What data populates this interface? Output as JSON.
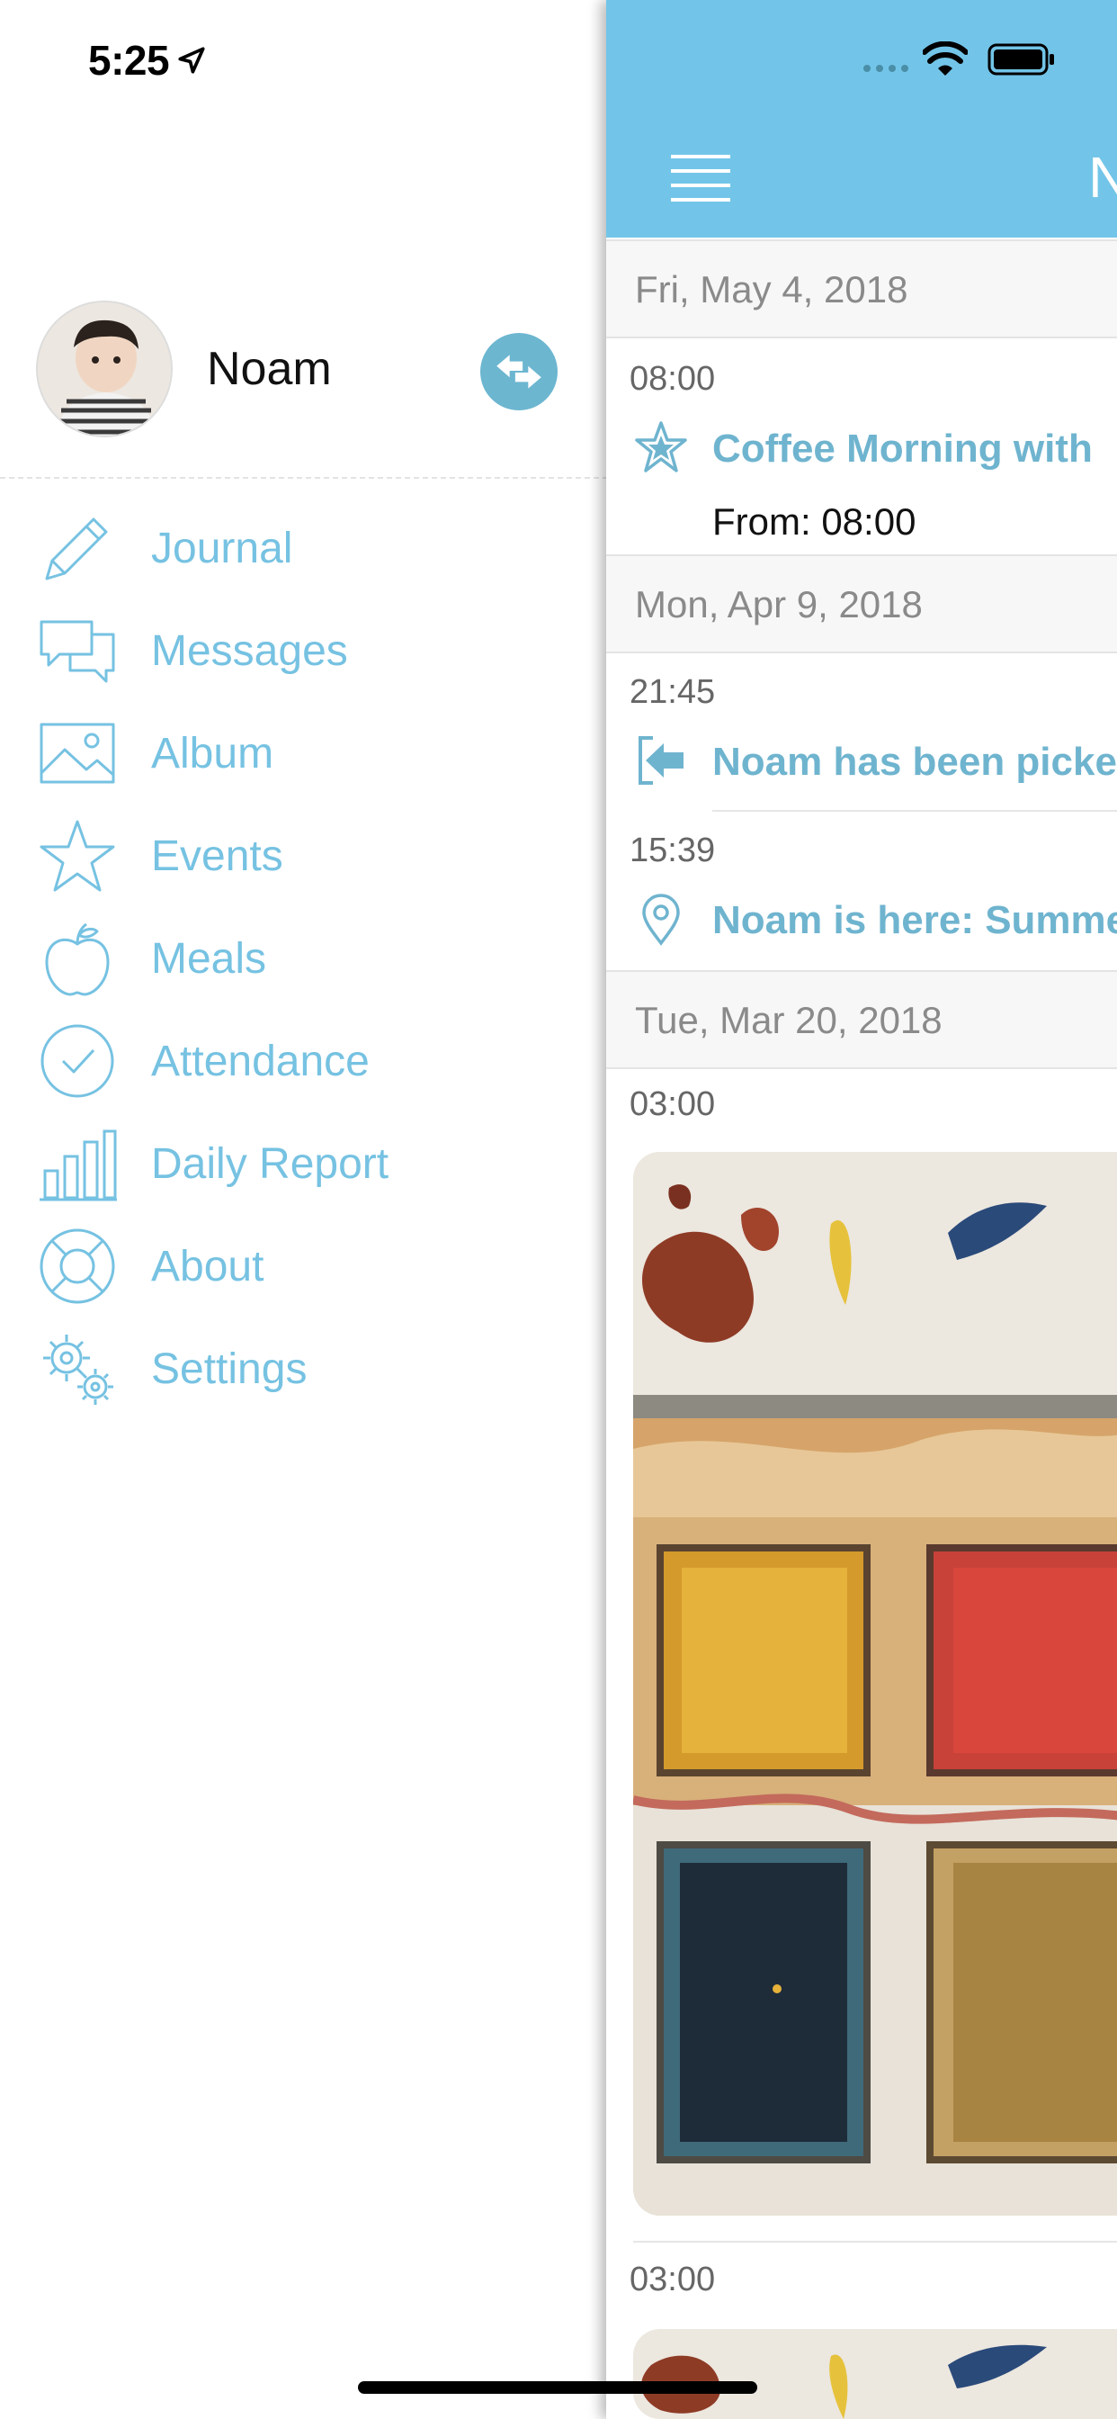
{
  "status_bar": {
    "time": "5:25"
  },
  "profile": {
    "name": "Noam"
  },
  "menu": [
    {
      "label": "Journal",
      "icon": "pencil-icon"
    },
    {
      "label": "Messages",
      "icon": "chat-bubbles-icon"
    },
    {
      "label": "Album",
      "icon": "image-icon"
    },
    {
      "label": "Events",
      "icon": "star-icon"
    },
    {
      "label": "Meals",
      "icon": "apple-icon"
    },
    {
      "label": "Attendance",
      "icon": "check-circle-icon"
    },
    {
      "label": "Daily Report",
      "icon": "bar-chart-icon"
    },
    {
      "label": "About",
      "icon": "lifebuoy-icon"
    },
    {
      "label": "Settings",
      "icon": "gears-icon"
    }
  ],
  "navbar": {
    "title": "N"
  },
  "feed": {
    "sections": [
      {
        "date": "Fri, May 4, 2018",
        "entries": [
          {
            "time": "08:00",
            "title": "Coffee Morning with",
            "subtitle": "From: 08:00",
            "icon": "star-icon"
          }
        ]
      },
      {
        "date": "Mon, Apr 9, 2018",
        "entries": [
          {
            "time": "21:45",
            "title": "Noam has been picke",
            "icon": "sign-out-icon"
          },
          {
            "time": "15:39",
            "title": "Noam is here: Summe",
            "icon": "location-pin-icon"
          }
        ]
      },
      {
        "date": "Tue, Mar 20, 2018",
        "entries": [
          {
            "time": "03:00",
            "icon": "photo"
          },
          {
            "time": "03:00",
            "icon": "photo"
          }
        ]
      }
    ]
  },
  "colors": {
    "accent": "#76c2e2",
    "navbar": "#72c5e8",
    "title_blue": "#6fb4cf"
  }
}
